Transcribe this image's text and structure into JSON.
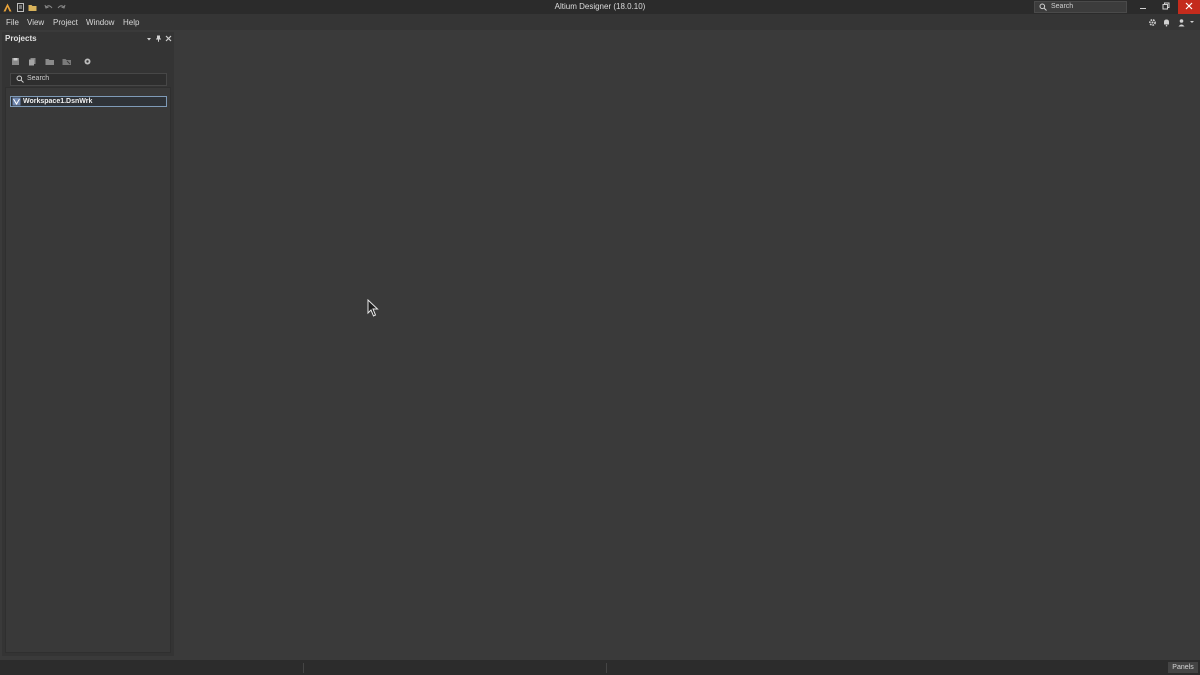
{
  "window": {
    "title": "Altium Designer (18.0.10)",
    "search_placeholder": "Search"
  },
  "menu": {
    "items": [
      "File",
      "View",
      "Project",
      "Window",
      "Help"
    ]
  },
  "projects_panel": {
    "title": "Projects",
    "search_placeholder": "Search",
    "tree": [
      {
        "label": "Workspace1.DsnWrk",
        "icon": "workspace-icon",
        "selected": true
      }
    ]
  },
  "status_bar": {
    "panels_label": "Panels"
  },
  "colors": {
    "accent_close": "#c42b1c",
    "logo": "#e8a33a",
    "selection_border": "#7f9bb8"
  }
}
